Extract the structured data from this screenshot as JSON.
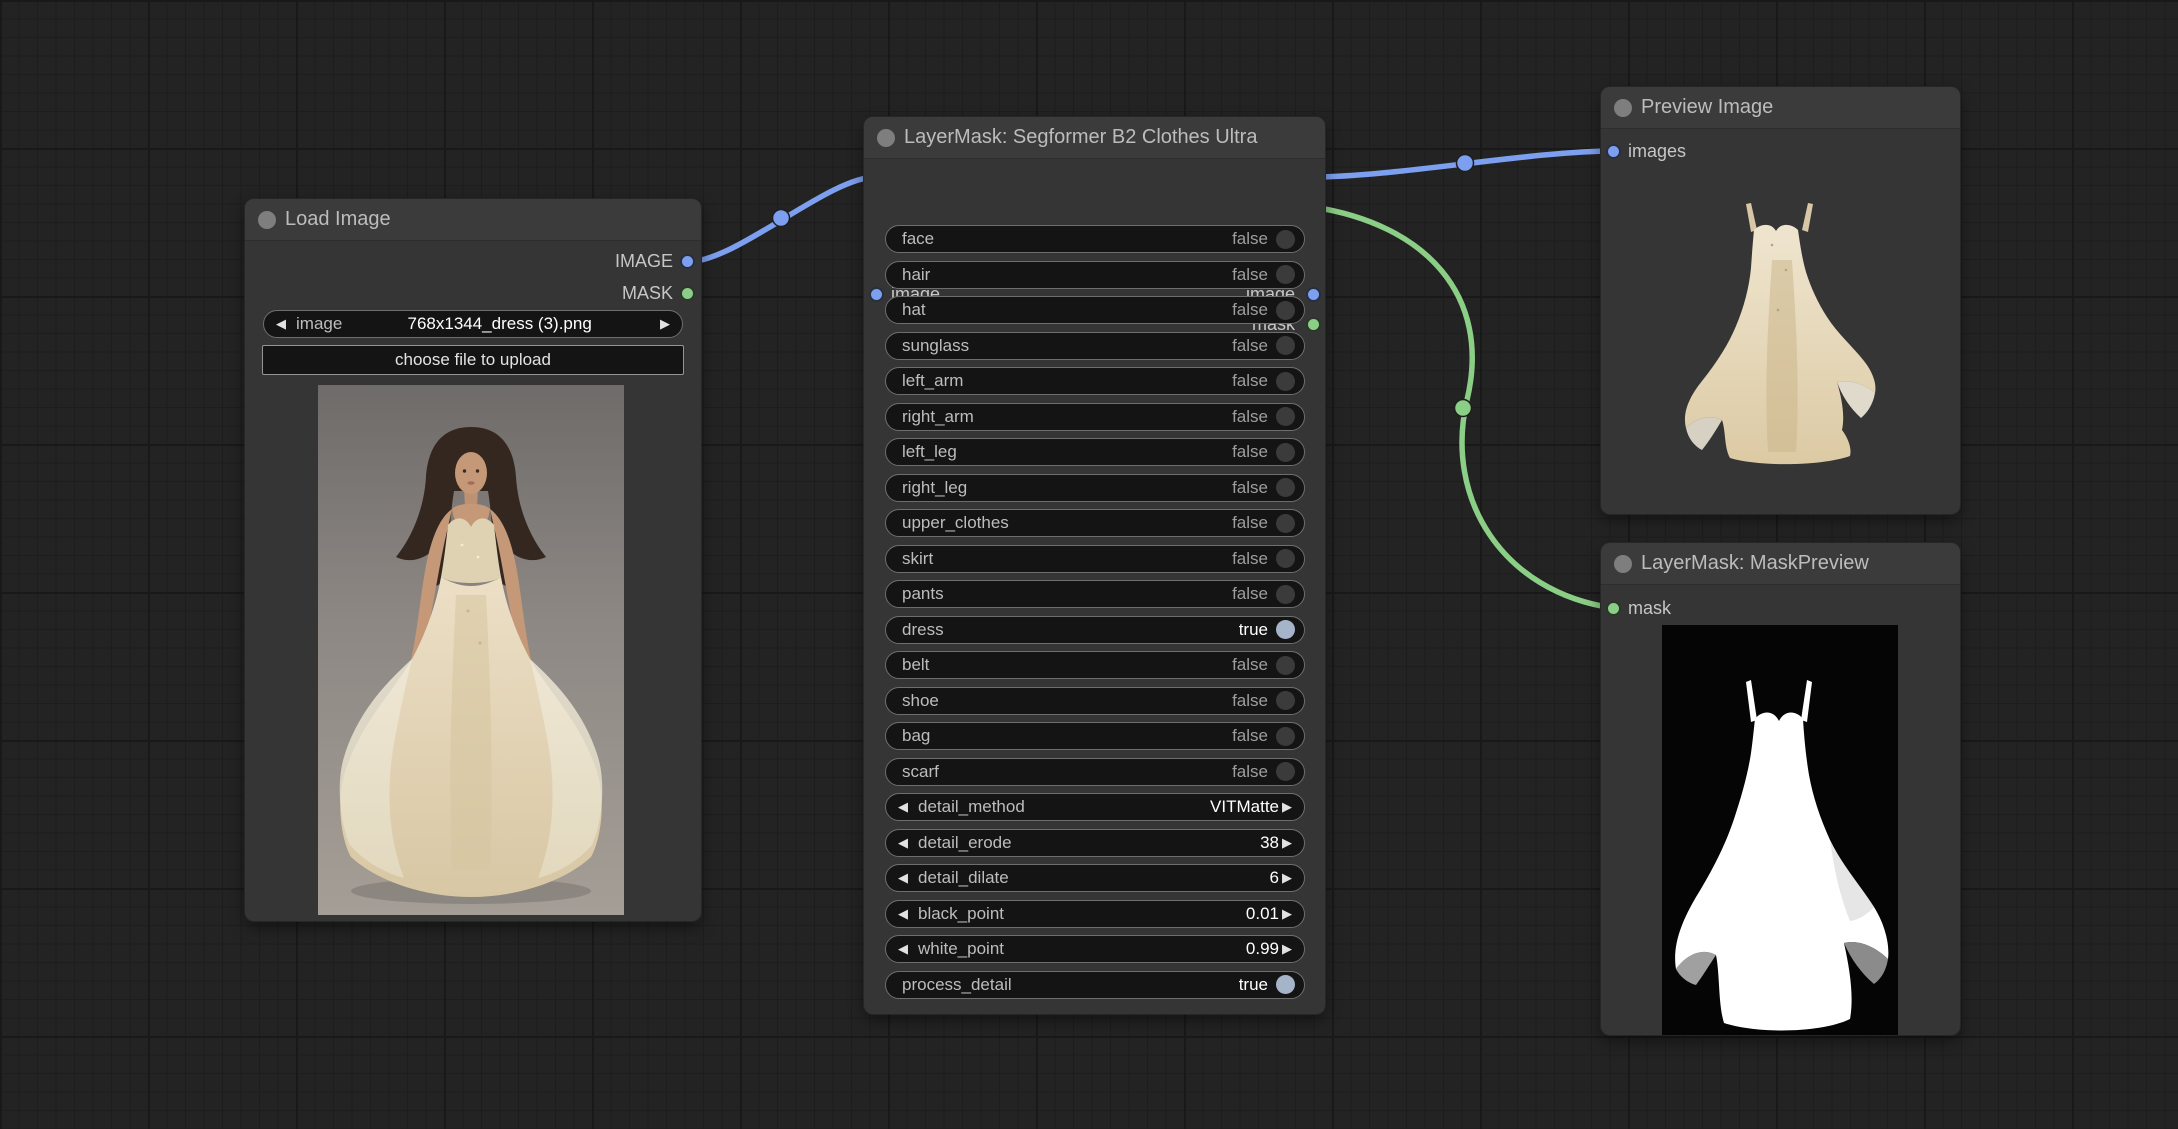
{
  "colors": {
    "link_image": "#7d9ff0",
    "link_mask": "#8bce85",
    "toggle_on": "#a6b4ca"
  },
  "load_image": {
    "title": "Load Image",
    "outputs": [
      {
        "label": "IMAGE"
      },
      {
        "label": "MASK"
      }
    ],
    "combo": {
      "label": "image",
      "value": "768x1344_dress (3).png"
    },
    "upload_label": "choose file to upload"
  },
  "seg": {
    "title": "LayerMask: Segformer B2 Clothes Ultra",
    "inputs": [
      {
        "label": "image"
      }
    ],
    "outputs": [
      {
        "label": "image"
      },
      {
        "label": "mask"
      }
    ],
    "widgets": [
      {
        "label": "face",
        "value": "false",
        "type": "toggle"
      },
      {
        "label": "hair",
        "value": "false",
        "type": "toggle"
      },
      {
        "label": "hat",
        "value": "false",
        "type": "toggle"
      },
      {
        "label": "sunglass",
        "value": "false",
        "type": "toggle"
      },
      {
        "label": "left_arm",
        "value": "false",
        "type": "toggle"
      },
      {
        "label": "right_arm",
        "value": "false",
        "type": "toggle"
      },
      {
        "label": "left_leg",
        "value": "false",
        "type": "toggle"
      },
      {
        "label": "right_leg",
        "value": "false",
        "type": "toggle"
      },
      {
        "label": "upper_clothes",
        "value": "false",
        "type": "toggle"
      },
      {
        "label": "skirt",
        "value": "false",
        "type": "toggle"
      },
      {
        "label": "pants",
        "value": "false",
        "type": "toggle"
      },
      {
        "label": "dress",
        "value": "true",
        "type": "toggle"
      },
      {
        "label": "belt",
        "value": "false",
        "type": "toggle"
      },
      {
        "label": "shoe",
        "value": "false",
        "type": "toggle"
      },
      {
        "label": "bag",
        "value": "false",
        "type": "toggle"
      },
      {
        "label": "scarf",
        "value": "false",
        "type": "toggle"
      },
      {
        "label": "detail_method",
        "value": "VITMatte",
        "type": "combo"
      },
      {
        "label": "detail_erode",
        "value": "38",
        "type": "combo"
      },
      {
        "label": "detail_dilate",
        "value": "6",
        "type": "combo"
      },
      {
        "label": "black_point",
        "value": "0.01",
        "type": "combo"
      },
      {
        "label": "white_point",
        "value": "0.99",
        "type": "combo"
      },
      {
        "label": "process_detail",
        "value": "true",
        "type": "toggle"
      }
    ]
  },
  "preview": {
    "title": "Preview Image",
    "inputs": [
      {
        "label": "images"
      }
    ]
  },
  "maskpreview": {
    "title": "LayerMask: MaskPreview",
    "inputs": [
      {
        "label": "mask"
      }
    ]
  }
}
